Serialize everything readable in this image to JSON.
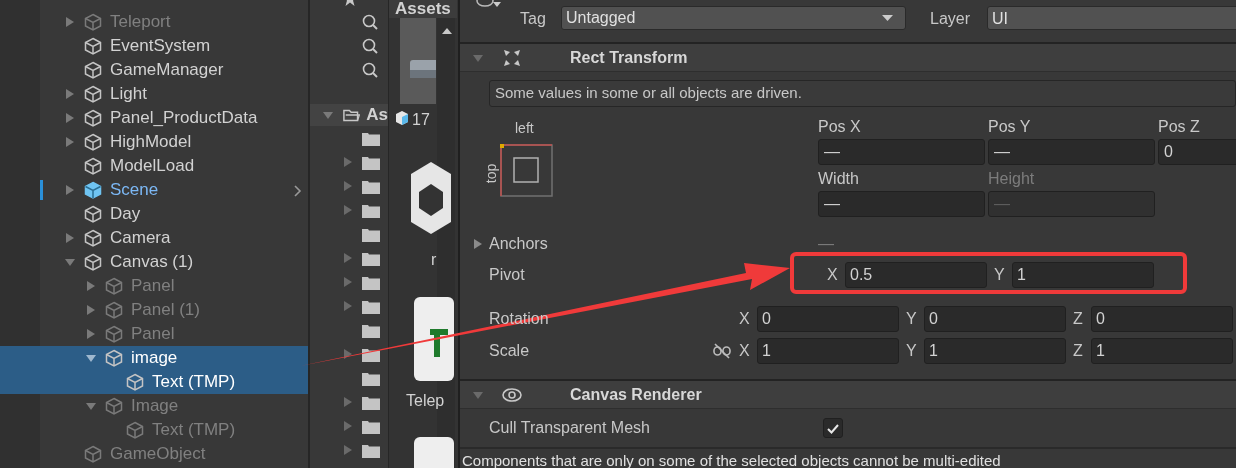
{
  "hierarchy": {
    "items": [
      {
        "name": "Teleport",
        "kind": "object",
        "dimmed": true,
        "selected": false,
        "expanded": false
      },
      {
        "name": "EventSystem",
        "kind": "object",
        "dimmed": false,
        "selected": false
      },
      {
        "name": "GameManager",
        "kind": "object",
        "dimmed": false,
        "selected": false
      },
      {
        "name": "Light",
        "kind": "object",
        "dimmed": false,
        "selected": false,
        "expanded": false
      },
      {
        "name": "Panel_ProductData",
        "kind": "object",
        "dimmed": false,
        "selected": false,
        "expanded": false
      },
      {
        "name": "HighModel",
        "kind": "object",
        "dimmed": false,
        "selected": false,
        "expanded": false
      },
      {
        "name": "ModelLoad",
        "kind": "object",
        "dimmed": false,
        "selected": false
      },
      {
        "name": "Scene",
        "kind": "prefab",
        "dimmed": false,
        "selected": false,
        "expanded": false
      },
      {
        "name": "Day",
        "kind": "object",
        "dimmed": false,
        "selected": false
      },
      {
        "name": "Camera",
        "kind": "object",
        "dimmed": false,
        "selected": false,
        "expanded": false
      },
      {
        "name": "Canvas (1)",
        "kind": "object",
        "dimmed": false,
        "selected": false,
        "expanded": true,
        "children": [
          {
            "name": "Panel",
            "kind": "object",
            "dimmed": true,
            "selected": false,
            "expanded": false
          },
          {
            "name": "Panel (1)",
            "kind": "object",
            "dimmed": true,
            "selected": false,
            "expanded": false
          },
          {
            "name": "Panel",
            "kind": "object",
            "dimmed": true,
            "selected": false,
            "expanded": false
          },
          {
            "name": "image",
            "kind": "object",
            "dimmed": false,
            "selected": true,
            "expanded": true,
            "children": [
              {
                "name": "Text (TMP)",
                "kind": "object",
                "dimmed": false,
                "selected": true
              }
            ]
          },
          {
            "name": "Image",
            "kind": "object",
            "dimmed": true,
            "selected": false,
            "expanded": true,
            "children": [
              {
                "name": "Text (TMP)",
                "kind": "object",
                "dimmed": true,
                "selected": false
              }
            ]
          }
        ]
      },
      {
        "name": "GameObject",
        "kind": "object",
        "dimmed": true,
        "selected": false
      }
    ]
  },
  "project": {
    "assets_label": "As",
    "folders": [
      {
        "expandable": false
      },
      {
        "expandable": true
      },
      {
        "expandable": true
      },
      {
        "expandable": true
      },
      {
        "expandable": false
      },
      {
        "expandable": true
      },
      {
        "expandable": true
      },
      {
        "expandable": true
      },
      {
        "expandable": false
      },
      {
        "expandable": true
      },
      {
        "expandable": false
      },
      {
        "expandable": true
      },
      {
        "expandable": true
      },
      {
        "expandable": true
      }
    ]
  },
  "asset_grid": {
    "tab": "Assets",
    "items": [
      {
        "kind": "model",
        "label": "17"
      },
      {
        "kind": "unity",
        "label": "r"
      },
      {
        "kind": "tmp",
        "label": "Telep"
      },
      {
        "kind": "tmp"
      }
    ]
  },
  "inspector": {
    "tag_label": "Tag",
    "tag": "Untagged",
    "layer_label": "Layer",
    "layer": "UI",
    "rect_transform": {
      "title": "Rect Transform",
      "expanded": true,
      "notice": "Some values in some or all objects are driven.",
      "anchor_preset": {
        "horizontal": "left",
        "vertical": "top"
      },
      "fields": [
        {
          "label": "Pos X",
          "value": "—",
          "disabled": false
        },
        {
          "label": "Pos Y",
          "value": "—",
          "disabled": false
        },
        {
          "label": "Pos Z",
          "value": "0",
          "disabled": false
        },
        {
          "label": "Width",
          "value": "—",
          "disabled": false
        },
        {
          "label": "Height",
          "value": "—",
          "disabled": true
        }
      ],
      "anchors": {
        "label": "Anchors",
        "value": "—",
        "expanded": false
      },
      "vectors": [
        {
          "label": "Pivot",
          "axes": [
            {
              "axis": "X",
              "value": "0.5"
            },
            {
              "axis": "Y",
              "value": "1"
            }
          ]
        },
        {
          "label": "Rotation",
          "axes": [
            {
              "axis": "X",
              "value": "0"
            },
            {
              "axis": "Y",
              "value": "0"
            },
            {
              "axis": "Z",
              "value": "0"
            }
          ]
        },
        {
          "label": "Scale",
          "constrained": false,
          "axes": [
            {
              "axis": "X",
              "value": "1"
            },
            {
              "axis": "Y",
              "value": "1"
            },
            {
              "axis": "Z",
              "value": "1"
            }
          ]
        }
      ]
    },
    "canvas_renderer": {
      "title": "Canvas Renderer",
      "expanded": true,
      "properties": [
        {
          "label": "Cull Transparent Mesh",
          "checked": true
        }
      ]
    },
    "footer_note": "Components that are only on some of the selected objects cannot be multi-edited"
  }
}
